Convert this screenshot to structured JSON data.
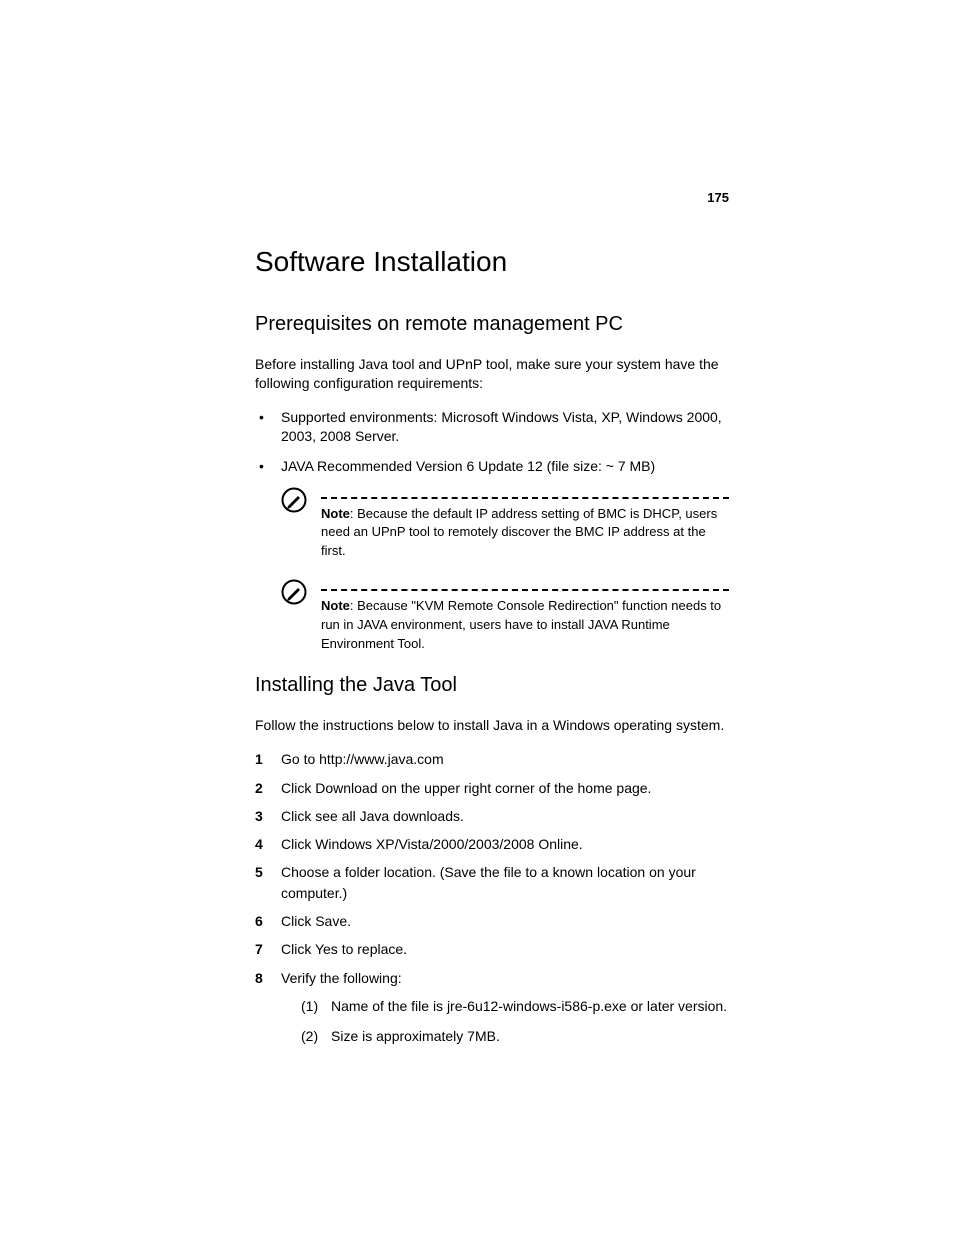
{
  "page_number": "175",
  "title": "Software Installation",
  "section1": {
    "heading": "Prerequisites on remote management PC",
    "intro": "Before installing Java tool and UPnP tool, make sure your system have the following configuration requirements:",
    "bullets": [
      "Supported environments: Microsoft Windows Vista, XP, Windows 2000, 2003, 2008 Server.",
      "JAVA Recommended Version 6 Update 12 (file size: ~ 7 MB)"
    ],
    "note1": {
      "label": "Note",
      "text": ": Because the default IP address setting of BMC is DHCP, users need an UPnP tool to remotely discover the BMC IP address at the first."
    },
    "note2": {
      "label": "Note",
      "text": ": Because \"KVM Remote Console Redirection\" function needs to run in JAVA environment, users have to install JAVA Runtime Environment Tool."
    }
  },
  "section2": {
    "heading": "Installing the Java Tool",
    "intro": "Follow the instructions below to install Java in a Windows operating system.",
    "steps": [
      "Go to http://www.java.com",
      "Click Download on the upper right corner of the home page.",
      "Click see all Java downloads.",
      "Click Windows XP/Vista/2000/2003/2008 Online.",
      "Choose a folder location. (Save the file to a known location on your computer.)",
      "Click Save.",
      "Click Yes to replace.",
      "Verify the following:"
    ],
    "substeps": [
      "Name of the file is jre-6u12-windows-i586-p.exe or later version.",
      "Size is approximately 7MB."
    ]
  }
}
